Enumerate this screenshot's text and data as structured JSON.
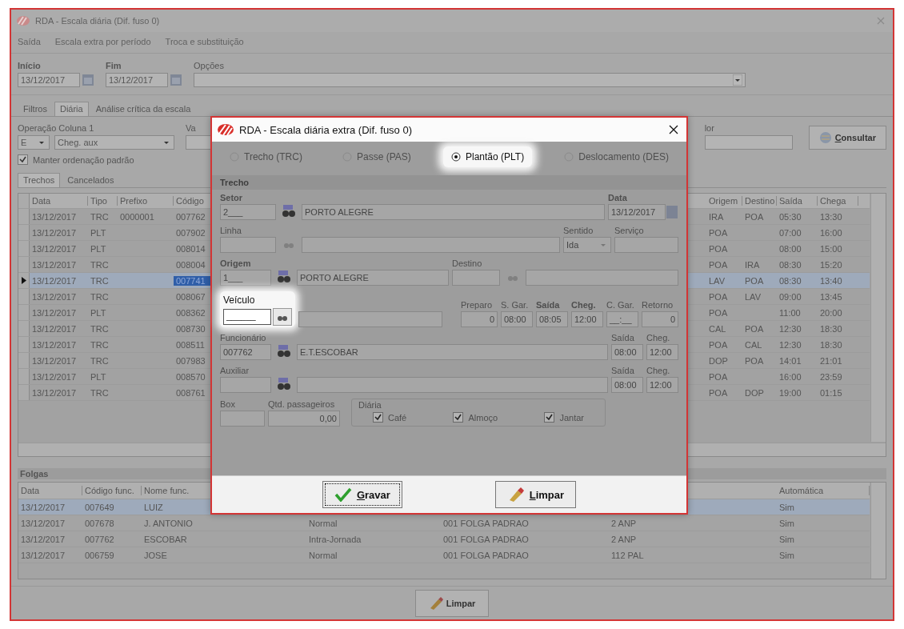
{
  "window": {
    "title": "RDA - Escala diária (Dif. fuso 0)"
  },
  "menu": [
    "Saída",
    "Escala extra por período",
    "Troca e substituição"
  ],
  "filters": {
    "inicio": {
      "label": "Início",
      "value": "13/12/2017"
    },
    "fim": {
      "label": "Fim",
      "value": "13/12/2017"
    },
    "opcoes": {
      "label": "Opções"
    }
  },
  "tabs": [
    {
      "label": "Filtros",
      "selected": false
    },
    {
      "label": "Diária",
      "selected": true
    },
    {
      "label": "Análise crítica da escala",
      "selected": false
    }
  ],
  "operacao": {
    "label": "Operação Coluna 1",
    "operator": "E",
    "column": "Cheg. aux",
    "value_label": "Va",
    "right_label": "lor"
  },
  "consultar_button": "Consultar",
  "keep_order": {
    "label": "Manter ordenação padrão",
    "checked": true
  },
  "subtabs": [
    {
      "label": "Trechos",
      "selected": true
    },
    {
      "label": "Cancelados",
      "selected": false
    }
  ],
  "trechos": {
    "columns_left": [
      "Data",
      "Tipo",
      "Prefixo",
      "Código"
    ],
    "columns_right": [
      "Origem",
      "Destino",
      "Saída",
      "Chega"
    ],
    "rows": [
      {
        "data": "13/12/2017",
        "tipo": "TRC",
        "prefixo": "0000001",
        "codigo": "007762",
        "origem": "IRA",
        "destino": "POA",
        "saida": "05:30",
        "chegada": "13:30",
        "selected": false
      },
      {
        "data": "13/12/2017",
        "tipo": "PLT",
        "codigo": "007902",
        "origem": "POA",
        "saida": "07:00",
        "chegada": "16:00",
        "selected": false
      },
      {
        "data": "13/12/2017",
        "tipo": "PLT",
        "codigo": "008014",
        "origem": "POA",
        "saida": "08:00",
        "chegada": "15:00",
        "selected": false
      },
      {
        "data": "13/12/2017",
        "tipo": "TRC",
        "codigo": "008004",
        "origem": "POA",
        "destino": "IRA",
        "saida": "08:30",
        "chegada": "15:20",
        "selected": false
      },
      {
        "data": "13/12/2017",
        "tipo": "TRC",
        "codigo": "007741",
        "origem": "LAV",
        "destino": "POA",
        "saida": "08:30",
        "chegada": "13:40",
        "selected": true
      },
      {
        "data": "13/12/2017",
        "tipo": "TRC",
        "codigo": "008067",
        "origem": "POA",
        "destino": "LAV",
        "saida": "09:00",
        "chegada": "13:45",
        "selected": false
      },
      {
        "data": "13/12/2017",
        "tipo": "PLT",
        "codigo": "008362",
        "origem": "POA",
        "saida": "11:00",
        "chegada": "20:00",
        "selected": false
      },
      {
        "data": "13/12/2017",
        "tipo": "TRC",
        "codigo": "008730",
        "origem": "CAL",
        "destino": "POA",
        "saida": "12:30",
        "chegada": "18:30",
        "selected": false
      },
      {
        "data": "13/12/2017",
        "tipo": "TRC",
        "codigo": "008511",
        "origem": "POA",
        "destino": "CAL",
        "saida": "12:30",
        "chegada": "18:30",
        "selected": false
      },
      {
        "data": "13/12/2017",
        "tipo": "TRC",
        "codigo": "007983",
        "origem": "DOP",
        "destino": "POA",
        "saida": "14:01",
        "chegada": "21:01",
        "selected": false
      },
      {
        "data": "13/12/2017",
        "tipo": "PLT",
        "codigo": "008570",
        "origem": "POA",
        "saida": "16:00",
        "chegada": "23:59",
        "selected": false
      },
      {
        "data": "13/12/2017",
        "tipo": "TRC",
        "codigo": "008761",
        "origem": "POA",
        "destino": "DOP",
        "saida": "19:00",
        "chegada": "01:15",
        "selected": false
      }
    ]
  },
  "folgas": {
    "title": "Folgas",
    "columns": [
      "Data",
      "Código func.",
      "Nome func."
    ],
    "last_column": "Automática",
    "rows": [
      {
        "data": "13/12/2017",
        "codigo": "007649",
        "nome": "LUIZ",
        "automatica": "Sim",
        "selected": true
      },
      {
        "data": "13/12/2017",
        "codigo": "007678",
        "nome": "J. ANTONIO",
        "column_4": "Normal",
        "column_5": "001 FOLGA PADRAO",
        "column_6": "2 ANP",
        "automatica": "Sim",
        "selected": false
      },
      {
        "data": "13/12/2017",
        "codigo": "007762",
        "nome": "ESCOBAR",
        "column_4": "Intra-Jornada",
        "column_5": "001 FOLGA PADRAO",
        "column_6": "2 ANP",
        "automatica": "Sim",
        "selected": false
      },
      {
        "data": "13/12/2017",
        "codigo": "006759",
        "nome": "JOSE",
        "column_4": "Normal",
        "column_5": "001 FOLGA PADRAO",
        "column_6": "112 PAL",
        "automatica": "Sim",
        "selected": false
      }
    ]
  },
  "bottom_button": "Limpar",
  "dialog": {
    "title": "RDA - Escala diária extra (Dif. fuso 0)",
    "types": [
      {
        "label": "Trecho (TRC)",
        "selected": false
      },
      {
        "label": "Passe (PAS)",
        "selected": false
      },
      {
        "label": "Plantão (PLT)",
        "selected": true
      },
      {
        "label": "Deslocamento (DES)",
        "selected": false
      }
    ],
    "section": "Trecho",
    "setor": {
      "label": "Setor",
      "code": "2___",
      "name": "PORTO ALEGRE"
    },
    "data": {
      "label": "Data",
      "value": "13/12/2017"
    },
    "linha": {
      "label": "Linha"
    },
    "sentido": {
      "label": "Sentido",
      "value": "Ida"
    },
    "servico": {
      "label": "Serviço"
    },
    "origem": {
      "label": "Origem",
      "code": "1___",
      "name": "PORTO ALEGRE"
    },
    "destino": {
      "label": "Destino"
    },
    "veiculo": {
      "label": "Veículo",
      "code": "______",
      "highlighted": true
    },
    "times": [
      {
        "label": "Preparo",
        "value": "0",
        "kind": "number",
        "bold": false
      },
      {
        "label": "S. Gar.",
        "value": "08:00",
        "kind": "time",
        "bold": false
      },
      {
        "label": "Saída",
        "value": "08:05",
        "kind": "time",
        "bold": true
      },
      {
        "label": "Cheg.",
        "value": "12:00",
        "kind": "time",
        "bold": true
      },
      {
        "label": "C. Gar.",
        "value": "__:__",
        "kind": "time",
        "bold": false
      },
      {
        "label": "Retorno",
        "value": "0",
        "kind": "number",
        "bold": false
      }
    ],
    "funcionario": {
      "label": "Funcionário",
      "code": "007762",
      "name": "E.T.ESCOBAR",
      "saida_label": "Saída",
      "saida": "08:00",
      "cheg_label": "Cheg.",
      "cheg": "12:00"
    },
    "auxiliar": {
      "label": "Auxiliar",
      "saida_label": "Saída",
      "saida": "08:00",
      "cheg_label": "Cheg.",
      "cheg": "12:00"
    },
    "box": {
      "label": "Box"
    },
    "passageiros": {
      "label": "Qtd. passageiros",
      "value": "0,00"
    },
    "diaria": {
      "label": "Diária",
      "items": [
        {
          "label": "Café",
          "checked": true
        },
        {
          "label": "Almoço",
          "checked": true
        },
        {
          "label": "Jantar",
          "checked": true
        }
      ]
    },
    "buttons": [
      {
        "label": "Gravar",
        "kind": "save"
      },
      {
        "label": "Limpar",
        "kind": "clear"
      }
    ]
  }
}
